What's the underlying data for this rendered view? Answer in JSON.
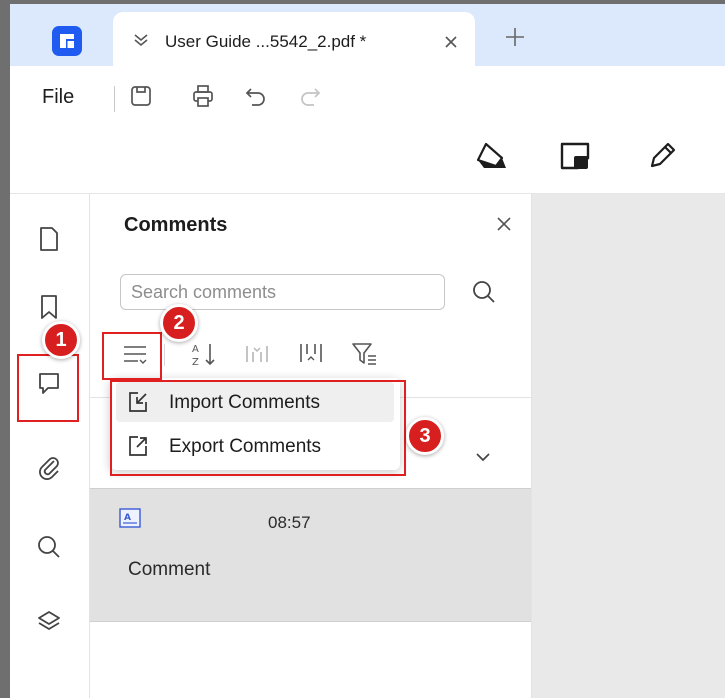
{
  "tab": {
    "title": "User Guide ...5542_2.pdf *"
  },
  "menu": {
    "file": "File"
  },
  "panel": {
    "title": "Comments",
    "search_placeholder": "Search comments"
  },
  "dropdown": {
    "items": [
      {
        "label": "Import Comments",
        "icon": "import-icon"
      },
      {
        "label": "Export Comments",
        "icon": "export-icon"
      }
    ]
  },
  "comment": {
    "time": "08:57",
    "text": "Comment",
    "icon": "text-annotation-icon"
  },
  "callouts": [
    "1",
    "2",
    "3"
  ],
  "colors": {
    "accent": "#1f5bf0",
    "tabbar": "#dce8fb",
    "highlight": "#e02020",
    "badge": "#d71f1f",
    "selected_row": "#e1e1e1",
    "doc_bg": "#e9e9e9"
  }
}
